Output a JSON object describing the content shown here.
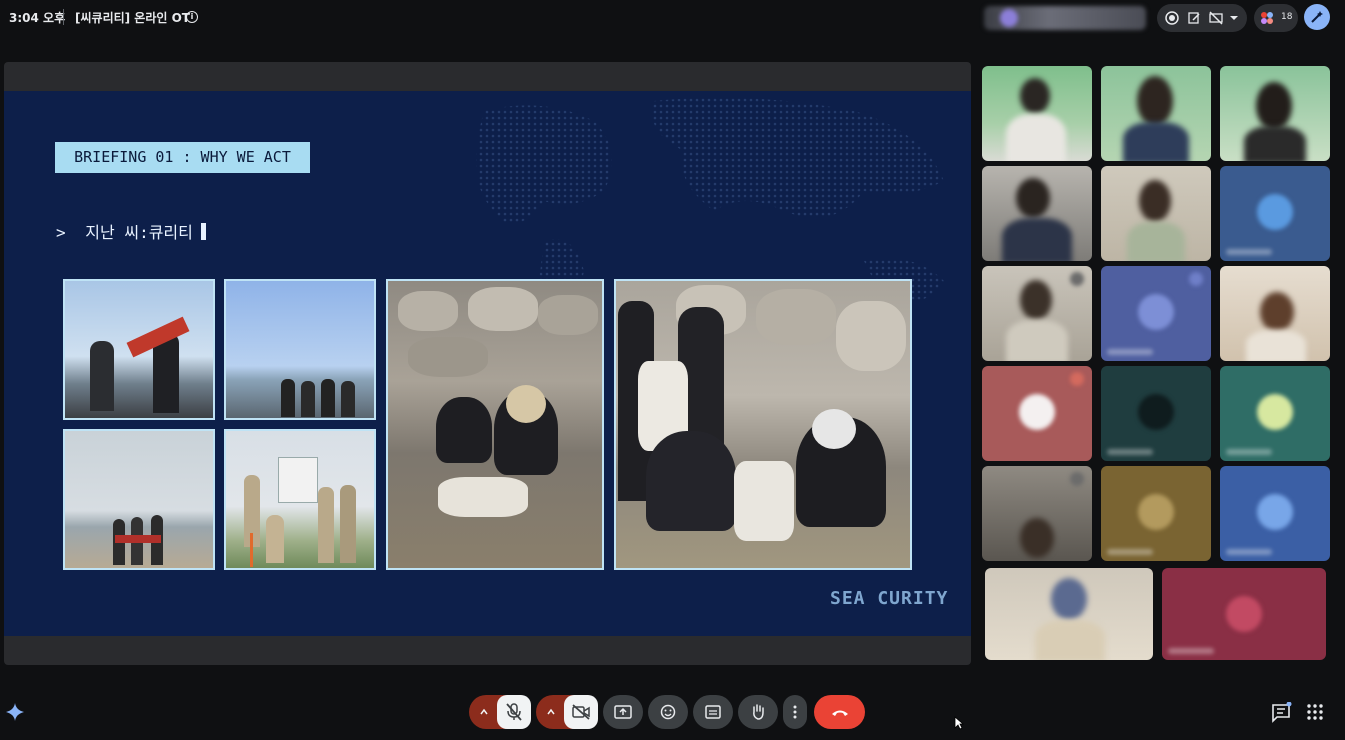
{
  "topbar": {
    "time": "3:04 오후",
    "meeting_title": "[씨큐리티] 온라인 OT",
    "participant_count": "18"
  },
  "slide": {
    "tag": "BRIEFING 01 : WHY WE ACT",
    "prompt_symbol": ">",
    "prompt_text": "지난 씨:큐리티",
    "brand": "SEA CURITY"
  },
  "icons": {
    "info": "info-icon",
    "record": "record-icon",
    "notes": "notes-icon",
    "captions_off": "captions-off-icon",
    "people": "people-icon",
    "ai": "ai-pen-icon",
    "gemini": "sparkle-icon",
    "mic_off": "mic-off-icon",
    "cam_off": "camera-off-icon",
    "present": "present-screen-icon",
    "emoji": "emoji-icon",
    "captions": "captions-icon",
    "hand": "raise-hand-icon",
    "more": "more-vert-icon",
    "hangup": "hang-up-icon",
    "chat": "chat-icon",
    "apps": "apps-grid-icon"
  },
  "colors": {
    "slide_bg": "#0d1f4a",
    "tag_bg": "#a8dcf2",
    "hangup": "#ea4335",
    "muted_bg": "#8c2c1c",
    "accent": "#8ab4f8"
  }
}
